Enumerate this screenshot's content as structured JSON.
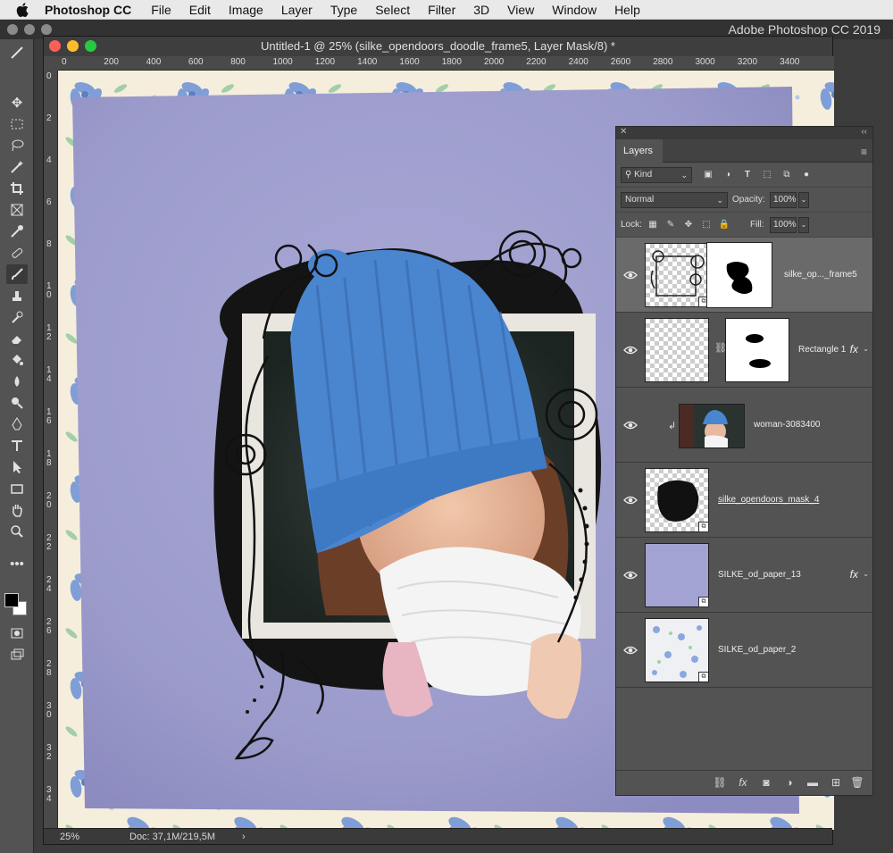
{
  "menubar": {
    "app": "Photoshop CC",
    "items": [
      "File",
      "Edit",
      "Image",
      "Layer",
      "Type",
      "Select",
      "Filter",
      "3D",
      "View",
      "Window",
      "Help"
    ]
  },
  "app_title": "Adobe Photoshop CC 2019",
  "document": {
    "title": "Untitled-1 @ 25% (silke_opendoors_doodle_frame5, Layer Mask/8) *",
    "ruler_h": [
      "0",
      "200",
      "400",
      "600",
      "800",
      "1000",
      "1200",
      "1400",
      "1600",
      "1800",
      "2000",
      "2200",
      "2400",
      "2600",
      "2800",
      "3000",
      "3200",
      "3400"
    ],
    "ruler_v": [
      "0",
      "2",
      "4",
      "6",
      "8",
      "1\n0",
      "1\n2",
      "1\n4",
      "1\n6",
      "1\n8",
      "2\n0",
      "2\n2",
      "2\n4",
      "2\n6",
      "2\n8",
      "3\n0",
      "3\n2",
      "3\n4"
    ],
    "zoom": "25%",
    "doc_size": "Doc: 37,1M/219,5M"
  },
  "layers_panel": {
    "tab": "Layers",
    "filter_kind": "Kind",
    "blend_mode": "Normal",
    "opacity_label": "Opacity:",
    "opacity_value": "100%",
    "lock_label": "Lock:",
    "fill_label": "Fill:",
    "fill_value": "100%",
    "layers": [
      {
        "name": "silke_op..._frame5",
        "selected": true,
        "has_mask": true,
        "fx": false
      },
      {
        "name": "Rectangle 1",
        "selected": false,
        "has_mask": true,
        "fx": true
      },
      {
        "name": "woman-3083400",
        "selected": false,
        "has_mask": false,
        "fx": false,
        "clipped": true
      },
      {
        "name": "silke_opendoors_mask_4",
        "selected": false,
        "has_mask": false,
        "fx": false,
        "underlined": true
      },
      {
        "name": "SILKE_od_paper_13",
        "selected": false,
        "has_mask": false,
        "fx": true
      },
      {
        "name": "SILKE_od_paper_2",
        "selected": false,
        "has_mask": false,
        "fx": false
      }
    ],
    "fx_label": "fx"
  },
  "icons": [
    "apple-icon",
    "move-tool-icon",
    "marquee-tool-icon",
    "lasso-tool-icon",
    "magic-wand-icon",
    "crop-tool-icon",
    "frame-tool-icon",
    "eyedropper-icon",
    "healing-brush-icon",
    "brush-tool-icon",
    "clone-stamp-icon",
    "history-brush-icon",
    "eraser-icon",
    "paint-bucket-icon",
    "blur-tool-icon",
    "dodge-tool-icon",
    "pen-tool-icon",
    "type-tool-icon",
    "path-selection-icon",
    "rectangle-tool-icon",
    "hand-tool-icon",
    "zoom-tool-icon",
    "more-tools-icon",
    "eye-icon",
    "link-icon",
    "trash-icon"
  ],
  "colors": {
    "foreground": "#000000",
    "background": "#ffffff",
    "paper": "#9c9ccc",
    "hat": "#4a86d0"
  }
}
